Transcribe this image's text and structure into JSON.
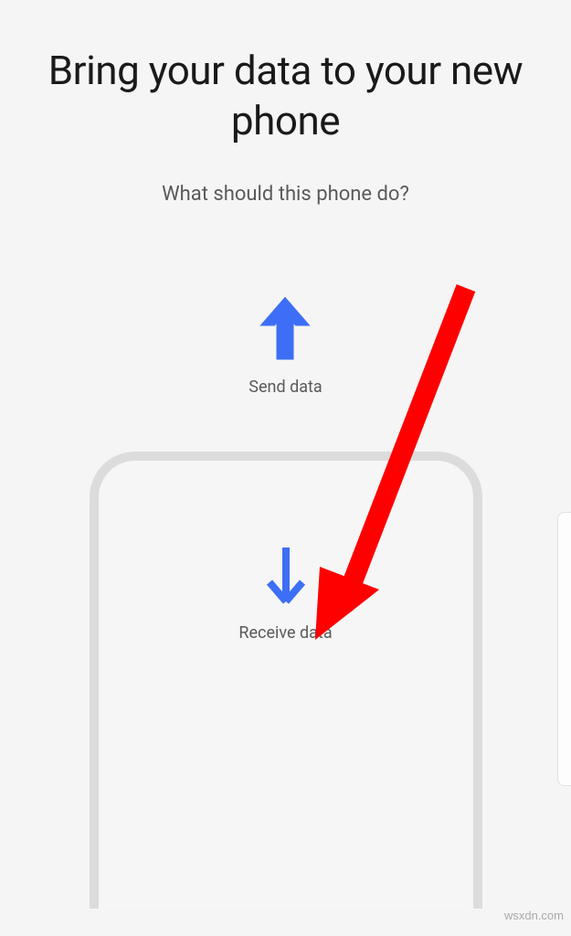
{
  "header": {
    "title": "Bring your data to your new phone",
    "subtitle": "What should this phone do?"
  },
  "options": {
    "send_label": "Send data",
    "receive_label": "Receive data"
  },
  "watermark": "wsxdn.com",
  "colors": {
    "arrow_blue": "#3d6ef5",
    "annotation_red": "#ff0000"
  }
}
